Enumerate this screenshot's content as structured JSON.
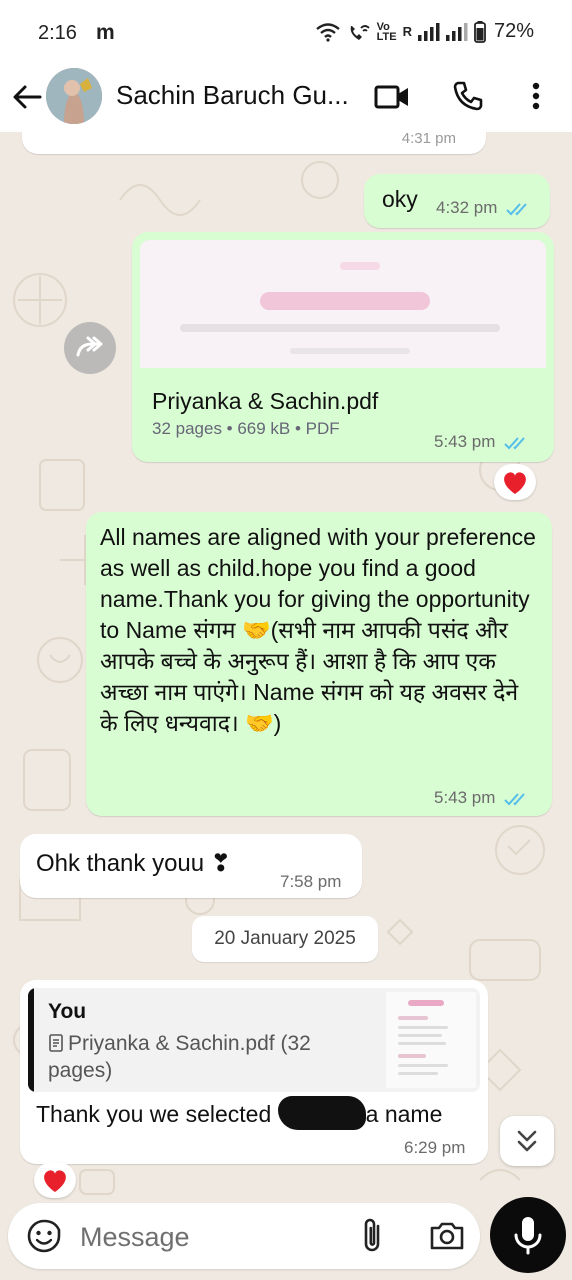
{
  "status_bar": {
    "time": "2:16",
    "notification_letter": "m",
    "volte_label_top": "Vo",
    "volte_label_bottom": "LTE",
    "signal1_label": "R",
    "battery_percent": "72%"
  },
  "header": {
    "contact_name": "Sachin Baruch Gu...",
    "icons": [
      "back-arrow-icon",
      "video-call-icon",
      "phone-icon",
      "more-vert-icon"
    ]
  },
  "messages": [
    {
      "type": "out_text",
      "text": "oky",
      "time": "4:32 pm",
      "status": "read"
    },
    {
      "type": "out_document",
      "file_name": "Priyanka & Sachin.pdf",
      "meta": "32 pages • 669 kB • PDF",
      "time": "5:43 pm",
      "status": "read",
      "reaction": "❤️"
    },
    {
      "type": "out_text",
      "text": "All names are aligned with your preference as well as child.hope you find a good name.Thank you for giving the opportunity to Name संगम 🤝(सभी नाम आपकी पसंद और आपके बच्चे के अनुरूप हैं। आशा है कि आप एक अच्छा नाम पाएंगे। Name संगम को यह अवसर देने के लिए धन्यवाद। 🤝)",
      "time": "5:43 pm",
      "status": "read"
    },
    {
      "type": "in_text",
      "text": "Ohk thank youu ❣",
      "time": "7:58 pm"
    },
    {
      "type": "date_divider",
      "text": "20 January 2025"
    },
    {
      "type": "in_reply",
      "quoted_sender": "You",
      "quoted_text": "Priyanka & Sachin.pdf (32 pages)",
      "text": "Thank you we selected ",
      "text_after": "a name",
      "time": "6:29 pm",
      "reaction": "❤️"
    }
  ],
  "partial_time_top": "4:31 pm",
  "composer": {
    "placeholder": "Message",
    "icons": [
      "emoji-sticker-icon",
      "attach-icon",
      "camera-icon",
      "mic-icon"
    ]
  },
  "colors": {
    "outgoing_bubble": "#d9fdd3",
    "incoming_bubble": "#ffffff",
    "read_ticks": "#53bdeb",
    "background": "#efe9e1",
    "mic_button": "#0b0b0b"
  }
}
